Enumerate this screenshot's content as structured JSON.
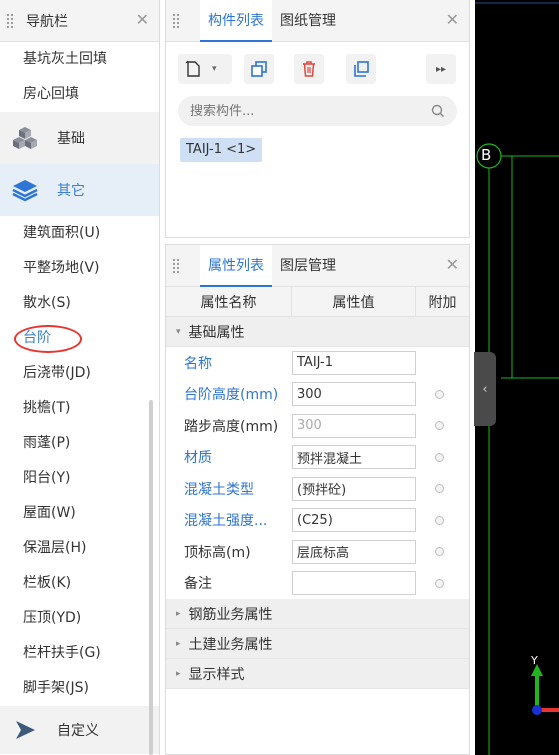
{
  "nav": {
    "title": "导航栏",
    "top_items": [
      "基坑灰土回填",
      "房心回填"
    ],
    "group_foundation": "基础",
    "group_other": "其它",
    "items": [
      "建筑面积(U)",
      "平整场地(V)",
      "散水(S)",
      "台阶",
      "后浇带(JD)",
      "挑檐(T)",
      "雨蓬(P)",
      "阳台(Y)",
      "屋面(W)",
      "保温层(H)",
      "栏板(K)",
      "压顶(YD)",
      "栏杆扶手(G)",
      "脚手架(JS)"
    ],
    "group_custom": "自定义"
  },
  "component_panel": {
    "tabs": [
      "构件列表",
      "图纸管理"
    ],
    "search_placeholder": "搜索构件...",
    "selected_component": "TAIJ-1 <1>"
  },
  "property_panel": {
    "tabs": [
      "属性列表",
      "图层管理"
    ],
    "columns": [
      "属性名称",
      "属性值",
      "附加"
    ],
    "sections": {
      "basic": "基础属性",
      "rebar": "钢筋业务属性",
      "civil": "土建业务属性",
      "display": "显示样式"
    },
    "rows": [
      {
        "name": "名称",
        "value": "TAIJ-1"
      },
      {
        "name": "台阶高度(mm)",
        "value": "300"
      },
      {
        "name": "踏步高度(mm)",
        "value": "300"
      },
      {
        "name": "材质",
        "value": "预拌混凝土"
      },
      {
        "name": "混凝土类型",
        "value": "(预拌砼)"
      },
      {
        "name": "混凝土强度...",
        "value": "(C25)"
      },
      {
        "name": "顶标高(m)",
        "value": "层底标高"
      },
      {
        "name": "备注",
        "value": ""
      }
    ]
  },
  "canvas": {
    "axis_label": "B",
    "y_axis_label": "Y"
  },
  "colors": {
    "accent_blue": "#2e75d4",
    "highlight_red": "#e8352f",
    "canvas_green": "#1fb51f"
  }
}
